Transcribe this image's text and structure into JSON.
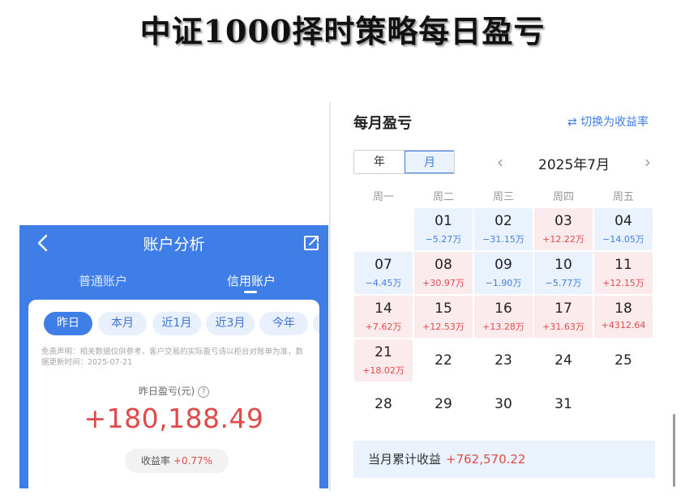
{
  "page_title": "中证1000择时策略每日盈亏",
  "account_panel": {
    "title": "账户分析",
    "back_icon": "chevron-left-icon",
    "share_icon": "share-icon",
    "account_tabs": [
      {
        "label": "普通账户",
        "active": false
      },
      {
        "label": "信用账户",
        "active": true
      }
    ],
    "periods": [
      {
        "label": "昨日",
        "active": true
      },
      {
        "label": "本月",
        "active": false
      },
      {
        "label": "近1月",
        "active": false
      },
      {
        "label": "近3月",
        "active": false
      },
      {
        "label": "今年",
        "active": false
      }
    ],
    "disclaimer": "免责声明：相关数据仅供参考，客户交易的实际盈亏请以柜台对账单为准，数据更新时间：2025-07-21",
    "pnl_label": "昨日盈亏(元)",
    "help_icon_text": "?",
    "pnl_value": "+180,188.49",
    "yield_label": "收益率",
    "yield_value": "+0.77%"
  },
  "calendar_panel": {
    "title": "每月盈亏",
    "switch_label": "⇄ 切换为收益率",
    "segments": [
      {
        "label": "年",
        "active": false
      },
      {
        "label": "月",
        "active": true
      }
    ],
    "prev_icon": "‹",
    "next_icon": "›",
    "month_label": "2025年7月",
    "weekdays": [
      "周一",
      "周二",
      "周三",
      "周四",
      "周五"
    ],
    "days": [
      {
        "day": "01",
        "amount": "−5.27万",
        "type": "loss",
        "row": 0,
        "col": 1
      },
      {
        "day": "02",
        "amount": "−31.15万",
        "type": "loss",
        "row": 0,
        "col": 2
      },
      {
        "day": "03",
        "amount": "+12.22万",
        "type": "gain",
        "row": 0,
        "col": 3
      },
      {
        "day": "04",
        "amount": "−14.05万",
        "type": "loss",
        "row": 0,
        "col": 4
      },
      {
        "day": "07",
        "amount": "−4.45万",
        "type": "loss",
        "row": 1,
        "col": 0
      },
      {
        "day": "08",
        "amount": "+30.97万",
        "type": "gain",
        "row": 1,
        "col": 1
      },
      {
        "day": "09",
        "amount": "−1.90万",
        "type": "loss",
        "row": 1,
        "col": 2
      },
      {
        "day": "10",
        "amount": "−5.77万",
        "type": "loss",
        "row": 1,
        "col": 3
      },
      {
        "day": "11",
        "amount": "+12.15万",
        "type": "gain",
        "row": 1,
        "col": 4
      },
      {
        "day": "14",
        "amount": "+7.62万",
        "type": "gain",
        "row": 2,
        "col": 0
      },
      {
        "day": "15",
        "amount": "+12.53万",
        "type": "gain",
        "row": 2,
        "col": 1
      },
      {
        "day": "16",
        "amount": "+13.28万",
        "type": "gain",
        "row": 2,
        "col": 2
      },
      {
        "day": "17",
        "amount": "+31.63万",
        "type": "gain",
        "row": 2,
        "col": 3
      },
      {
        "day": "18",
        "amount": "+4312.64",
        "type": "gain",
        "row": 2,
        "col": 4
      },
      {
        "day": "21",
        "amount": "+18.02万",
        "type": "gain",
        "row": 3,
        "col": 0
      },
      {
        "day": "22",
        "amount": "",
        "type": "plain",
        "row": 3,
        "col": 1
      },
      {
        "day": "23",
        "amount": "",
        "type": "plain",
        "row": 3,
        "col": 2
      },
      {
        "day": "24",
        "amount": "",
        "type": "plain",
        "row": 3,
        "col": 3
      },
      {
        "day": "25",
        "amount": "",
        "type": "plain",
        "row": 3,
        "col": 4
      },
      {
        "day": "28",
        "amount": "",
        "type": "plain",
        "row": 4,
        "col": 0
      },
      {
        "day": "29",
        "amount": "",
        "type": "plain",
        "row": 4,
        "col": 1
      },
      {
        "day": "30",
        "amount": "",
        "type": "plain",
        "row": 4,
        "col": 2
      },
      {
        "day": "31",
        "amount": "",
        "type": "plain",
        "row": 4,
        "col": 3
      }
    ],
    "summary_label": "当月累计收益",
    "summary_value": "+762,570.22"
  },
  "colors": {
    "brand_blue": "#3f7ee7",
    "gain_red": "#e04a4a",
    "gain_bg": "#fcebed",
    "loss_bg": "#eaf2fe"
  }
}
